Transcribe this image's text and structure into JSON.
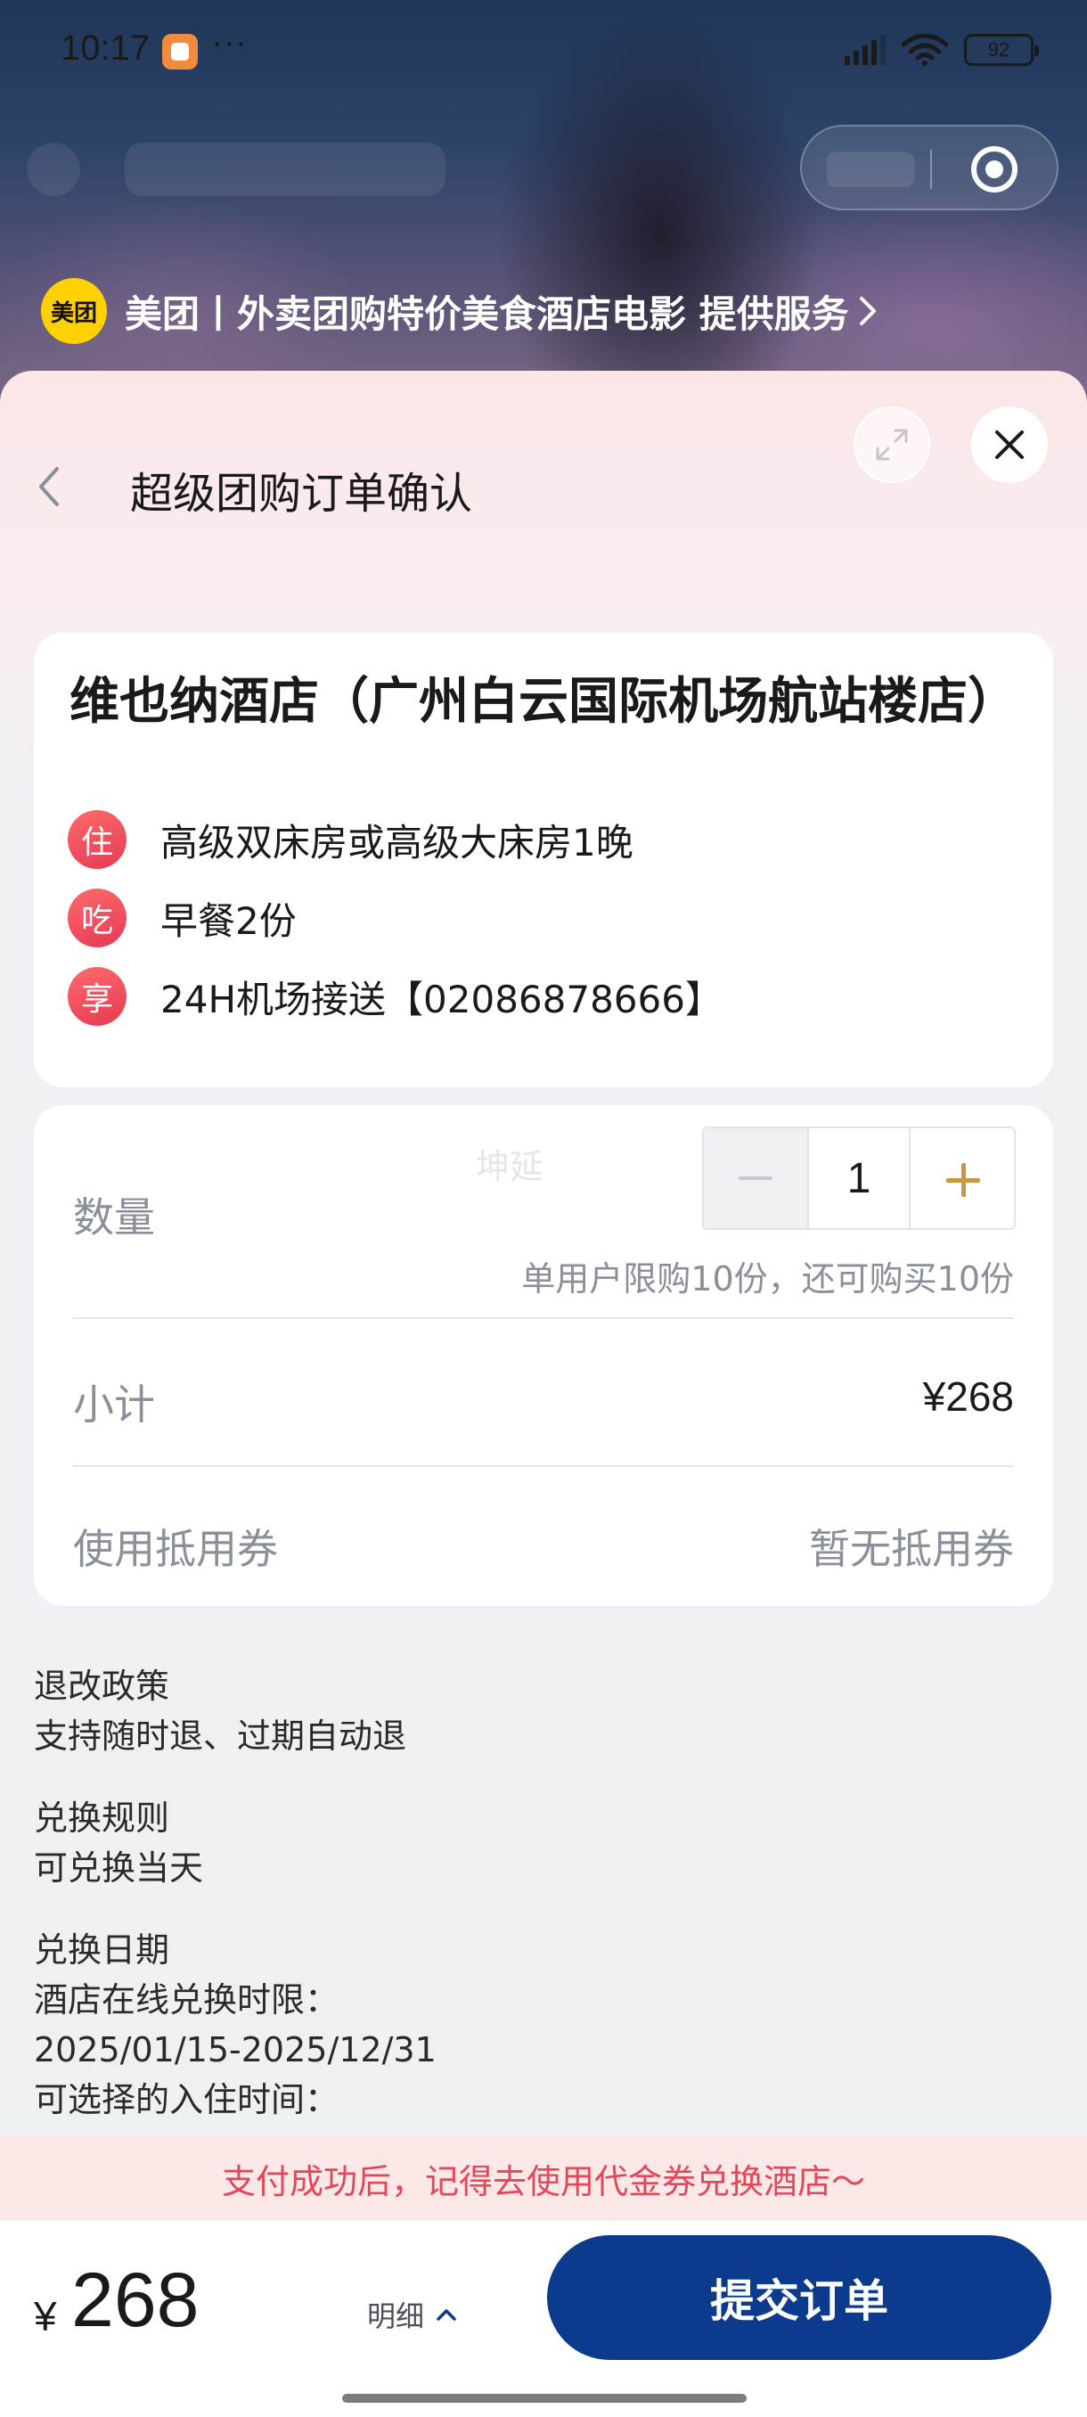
{
  "status_bar": {
    "time": "10:17",
    "more": "···",
    "battery": "92"
  },
  "provider": {
    "logo_text": "美团",
    "text": "美团丨外卖团购特价美食酒店电影 提供服务"
  },
  "sheet": {
    "title": "超级团购订单确认"
  },
  "hotel": {
    "name": "维也纳酒店（广州白云国际机场航站楼店）",
    "perks": [
      {
        "badge": "住",
        "text": "高级双床房或高级大床房1晚"
      },
      {
        "badge": "吃",
        "text": "早餐2份"
      },
      {
        "badge": "享",
        "text": "24H机场接送【02086878666】"
      }
    ]
  },
  "order": {
    "quantity_label": "数量",
    "watermark": "坤延",
    "quantity_value": "1",
    "limit_text": "单用户限购10份，还可购买10份",
    "subtotal_label": "小计",
    "subtotal_value": "¥268",
    "coupon_label": "使用抵用券",
    "coupon_value": "暂无抵用券"
  },
  "policies": [
    {
      "title": "退改政策",
      "lines": [
        "支持随时退、过期自动退"
      ]
    },
    {
      "title": "兑换规则",
      "lines": [
        "可兑换当天"
      ]
    },
    {
      "title": "兑换日期",
      "lines": [
        "酒店在线兑换时限：",
        "2025/01/15-2025/12/31",
        "可选择的入住时间："
      ]
    }
  ],
  "notice": "支付成功后，记得去使用代金券兑换酒店～",
  "bottom": {
    "currency": "¥",
    "price": "268",
    "detail_label": "明细",
    "submit_label": "提交订单"
  },
  "colors": {
    "brand_blue": "#0c3a8c",
    "accent_gold": "#c9973e",
    "notice_red": "#e2475a",
    "meituan_yellow": "#ffd100"
  }
}
